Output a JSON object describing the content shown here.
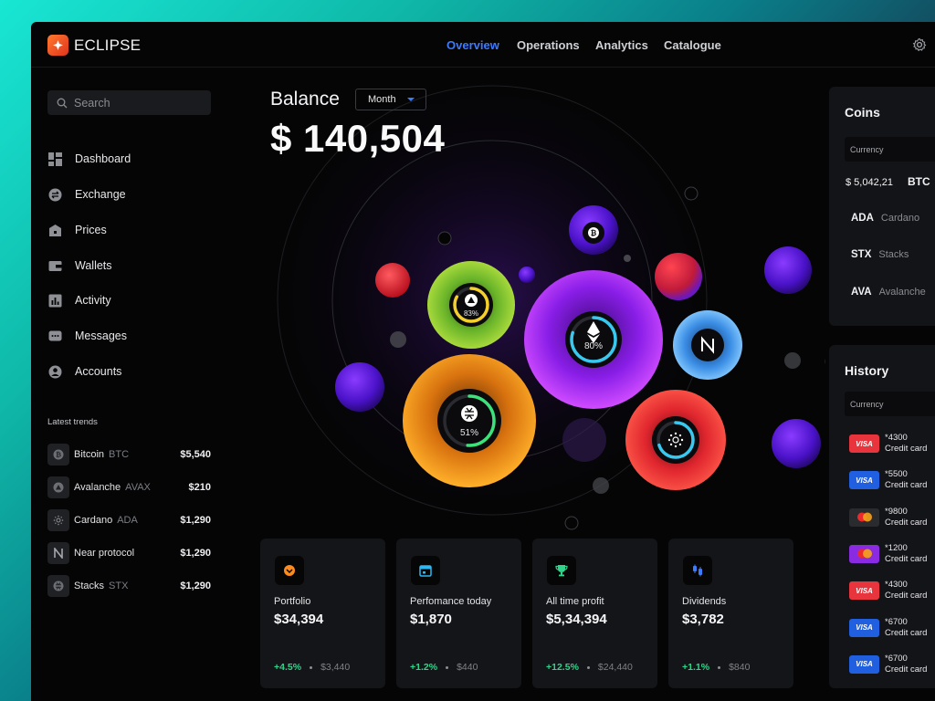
{
  "app": {
    "name": "ECLIPSE"
  },
  "nav": [
    {
      "label": "Overview",
      "active": true
    },
    {
      "label": "Operations",
      "active": false
    },
    {
      "label": "Analytics",
      "active": false
    },
    {
      "label": "Catalogue",
      "active": false
    }
  ],
  "search": {
    "placeholder": "Search"
  },
  "sidebar": {
    "items": [
      {
        "label": "Dashboard",
        "icon": "dashboard-icon"
      },
      {
        "label": "Exchange",
        "icon": "exchange-icon"
      },
      {
        "label": "Prices",
        "icon": "prices-icon"
      },
      {
        "label": "Wallets",
        "icon": "wallet-icon"
      },
      {
        "label": "Activity",
        "icon": "activity-icon"
      },
      {
        "label": "Messages",
        "icon": "messages-icon"
      },
      {
        "label": "Accounts",
        "icon": "accounts-icon"
      }
    ],
    "trends_title": "Latest trends",
    "trends": [
      {
        "name": "Bitcoin",
        "symbol": "BTC",
        "value": "$5,540"
      },
      {
        "name": "Avalanche",
        "symbol": "AVAX",
        "value": "$210"
      },
      {
        "name": "Cardano",
        "symbol": "ADA",
        "value": "$1,290"
      },
      {
        "name": "Near protocol",
        "symbol": "",
        "value": "$1,290"
      },
      {
        "name": "Stacks",
        "symbol": "STX",
        "value": "$1,290"
      }
    ]
  },
  "balance": {
    "title": "Balance",
    "period": "Month",
    "value": "$ 140,504"
  },
  "bubbles": [
    {
      "coin": "ETH",
      "percent": "80%",
      "progress": 0.8
    },
    {
      "coin": "STX",
      "percent": "51%",
      "progress": 0.51
    },
    {
      "coin": "AVAX",
      "percent": "83%",
      "progress": 0.83
    },
    {
      "coin": "ADA",
      "percent": "",
      "progress": 0.7
    },
    {
      "coin": "BTC",
      "percent": "",
      "progress": 0
    },
    {
      "coin": "NEAR",
      "percent": "",
      "progress": 0
    }
  ],
  "cards": [
    {
      "label": "Portfolio",
      "value": "$34,394",
      "change": "+4.5%",
      "amount": "$3,440",
      "icon": "portfolio-icon",
      "color": "#ff8a1e"
    },
    {
      "label": "Perfomance today",
      "value": "$1,870",
      "change": "+1.2%",
      "amount": "$440",
      "icon": "calendar-icon",
      "color": "#2fb7f0"
    },
    {
      "label": "All time profit",
      "value": "$5,34,394",
      "change": "+12.5%",
      "amount": "$24,440",
      "icon": "trophy-icon",
      "color": "#2fd48a"
    },
    {
      "label": "Dividends",
      "value": "$3,782",
      "change": "+1.1%",
      "amount": "$840",
      "icon": "dividends-icon",
      "color": "#3b7bff"
    }
  ],
  "coins": {
    "title": "Coins",
    "header": "Currency",
    "top_value": "$ 5,042,21",
    "top_symbol": "BTC",
    "rows": [
      {
        "symbol": "ADA",
        "name": "Cardano"
      },
      {
        "symbol": "STX",
        "name": "Stacks"
      },
      {
        "symbol": "AVA",
        "name": "Avalanche"
      }
    ]
  },
  "history": {
    "title": "History",
    "header": "Currency",
    "rows": [
      {
        "card": "*4300",
        "type": "Credit card",
        "brand": "VISA",
        "color": "#e8343c"
      },
      {
        "card": "*5500",
        "type": "Credit card",
        "brand": "VISA",
        "color": "#1f5fe0"
      },
      {
        "card": "*9800",
        "type": "Credit card",
        "brand": "MC",
        "color": "#2a2b2f"
      },
      {
        "card": "*1200",
        "type": "Credit card",
        "brand": "MC",
        "color": "#8a2be2"
      },
      {
        "card": "*4300",
        "type": "Credit card",
        "brand": "VISA",
        "color": "#e8343c"
      },
      {
        "card": "*6700",
        "type": "Credit card",
        "brand": "VISA",
        "color": "#1f5fe0"
      },
      {
        "card": "*6700",
        "type": "Credit card",
        "brand": "VISA",
        "color": "#1f5fe0"
      }
    ]
  }
}
